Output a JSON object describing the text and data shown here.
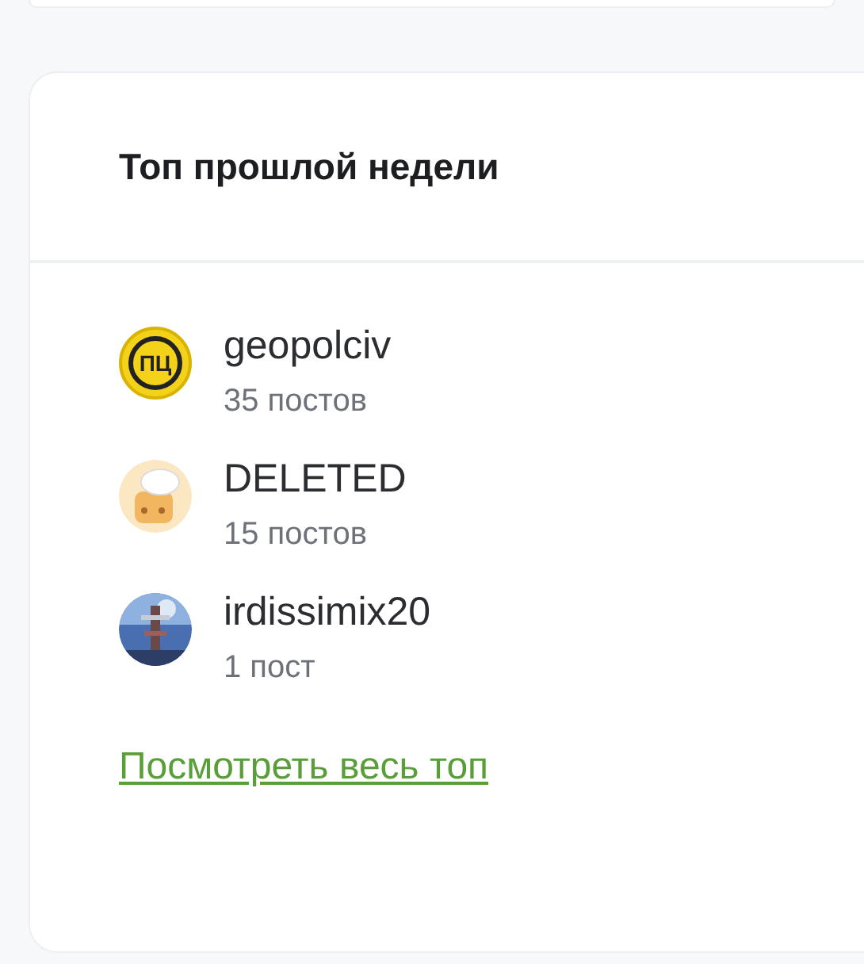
{
  "card": {
    "title": "Топ прошлой недели"
  },
  "users": [
    {
      "name": "geopolciv",
      "posts": "35 постов",
      "avatar": {
        "kind": "logo",
        "text": "ПЦ"
      }
    },
    {
      "name": "DELETED",
      "posts": "15 постов",
      "avatar": {
        "kind": "toaster"
      }
    },
    {
      "name": "irdissimix20",
      "posts": "1 пост"
    }
  ],
  "link": "Посмотреть весь топ"
}
